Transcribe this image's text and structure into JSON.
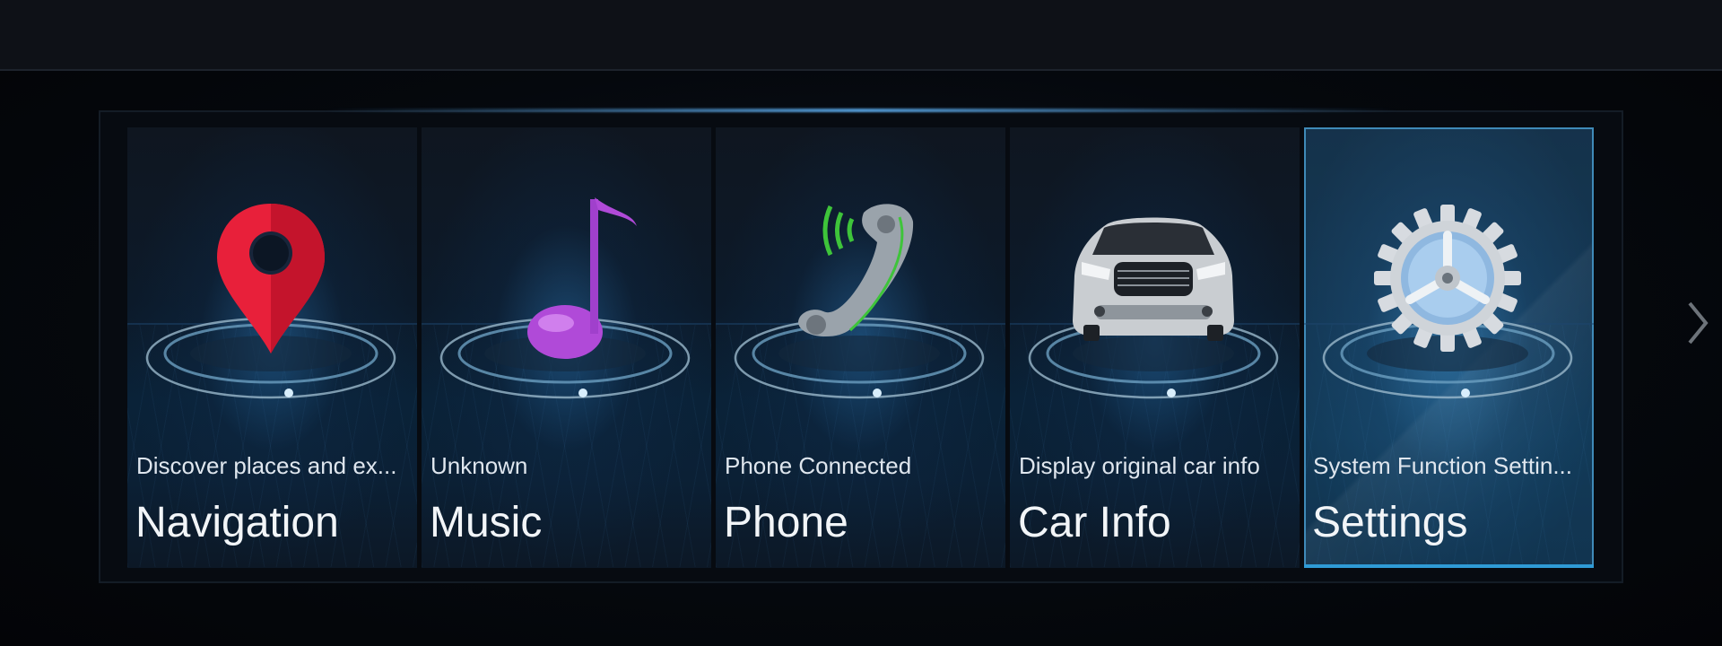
{
  "tiles": [
    {
      "id": "navigation",
      "subtitle": "Discover places and ex...",
      "title": "Navigation",
      "icon": "map-pin-icon",
      "selected": false
    },
    {
      "id": "music",
      "subtitle": "Unknown",
      "title": "Music",
      "icon": "music-note-icon",
      "selected": false
    },
    {
      "id": "phone",
      "subtitle": "Phone Connected",
      "title": "Phone",
      "icon": "phone-handset-icon",
      "selected": false
    },
    {
      "id": "car-info",
      "subtitle": "Display original car info",
      "title": "Car Info",
      "icon": "car-icon",
      "selected": false
    },
    {
      "id": "settings",
      "subtitle": "System Function Settin...",
      "title": "Settings",
      "icon": "gear-icon",
      "selected": true
    }
  ],
  "colors": {
    "pin": "#e8203a",
    "note": "#b04ad8",
    "phone_wave": "#3ec43a",
    "selected_border": "#3f8ab8"
  },
  "next_icon": "chevron-right-icon"
}
